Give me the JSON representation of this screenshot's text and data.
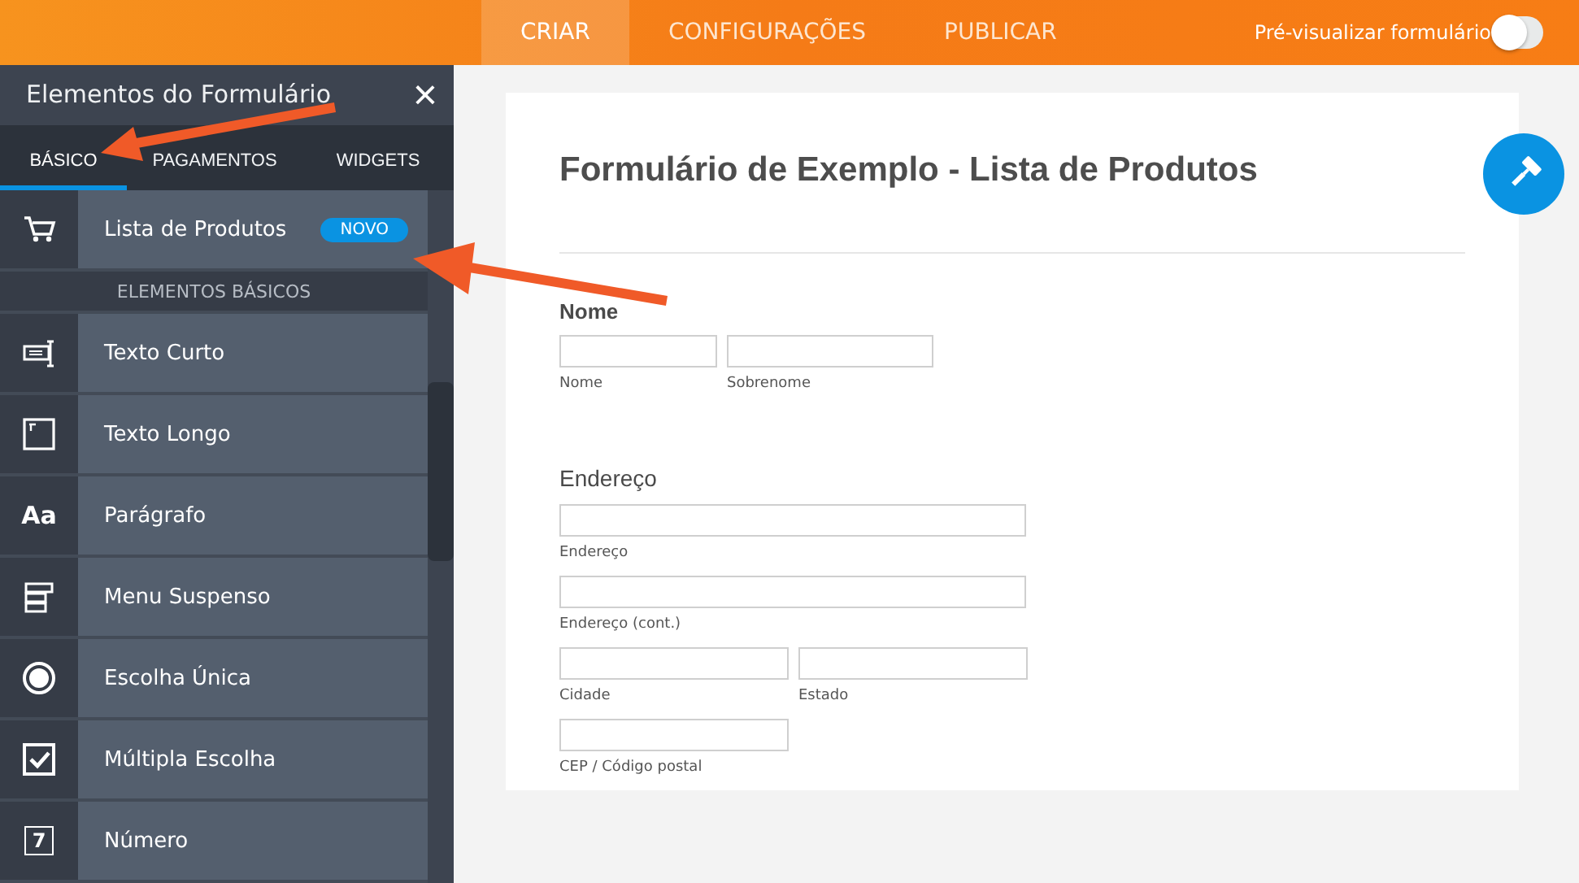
{
  "top_bar": {
    "tabs": [
      {
        "label": "CRIAR",
        "selected": true
      },
      {
        "label": "CONFIGURAÇÕES",
        "selected": false
      },
      {
        "label": "PUBLICAR",
        "selected": false
      }
    ],
    "preview": {
      "label": "Pré-visualizar formulário",
      "on": false
    }
  },
  "sidebar": {
    "title": "Elementos do Formulário",
    "close": "×",
    "tabs": [
      {
        "label": "BÁSICO",
        "selected": true
      },
      {
        "label": "PAGAMENTOS",
        "selected": false
      },
      {
        "label": "WIDGETS",
        "selected": false
      }
    ],
    "featured": {
      "label": "Lista de Produtos",
      "badge": "NOVO",
      "kind": "cart"
    },
    "section_title": "ELEMENTOS BÁSICOS",
    "items": [
      {
        "label": "Texto Curto",
        "kind": "short-text"
      },
      {
        "label": "Texto Longo",
        "kind": "long-text"
      },
      {
        "label": "Parágrafo",
        "kind": "paragraph",
        "icon_text": "Aa"
      },
      {
        "label": "Menu Suspenso",
        "kind": "dropdown"
      },
      {
        "label": "Escolha Única",
        "kind": "radio"
      },
      {
        "label": "Múltipla Escolha",
        "kind": "checkbox"
      },
      {
        "label": "Número",
        "kind": "number",
        "icon_text": "7"
      }
    ]
  },
  "form": {
    "title": "Formulário de Exemplo - Lista de Produtos",
    "sections": [
      {
        "label": "Nome",
        "rows": [
          [
            {
              "sublabel": "Nome",
              "kind": "small"
            },
            {
              "sublabel": "Sobrenome",
              "kind": "medium"
            }
          ]
        ]
      },
      {
        "label": "Endereço",
        "rows": [
          [
            {
              "sublabel": "Endereço",
              "kind": "full"
            }
          ],
          [
            {
              "sublabel": "Endereço (cont.)",
              "kind": "full"
            }
          ],
          [
            {
              "sublabel": "Cidade",
              "kind": "half"
            },
            {
              "sublabel": "Estado",
              "kind": "half"
            }
          ],
          [
            {
              "sublabel": "CEP / Código postal",
              "kind": "half"
            }
          ]
        ]
      }
    ]
  }
}
